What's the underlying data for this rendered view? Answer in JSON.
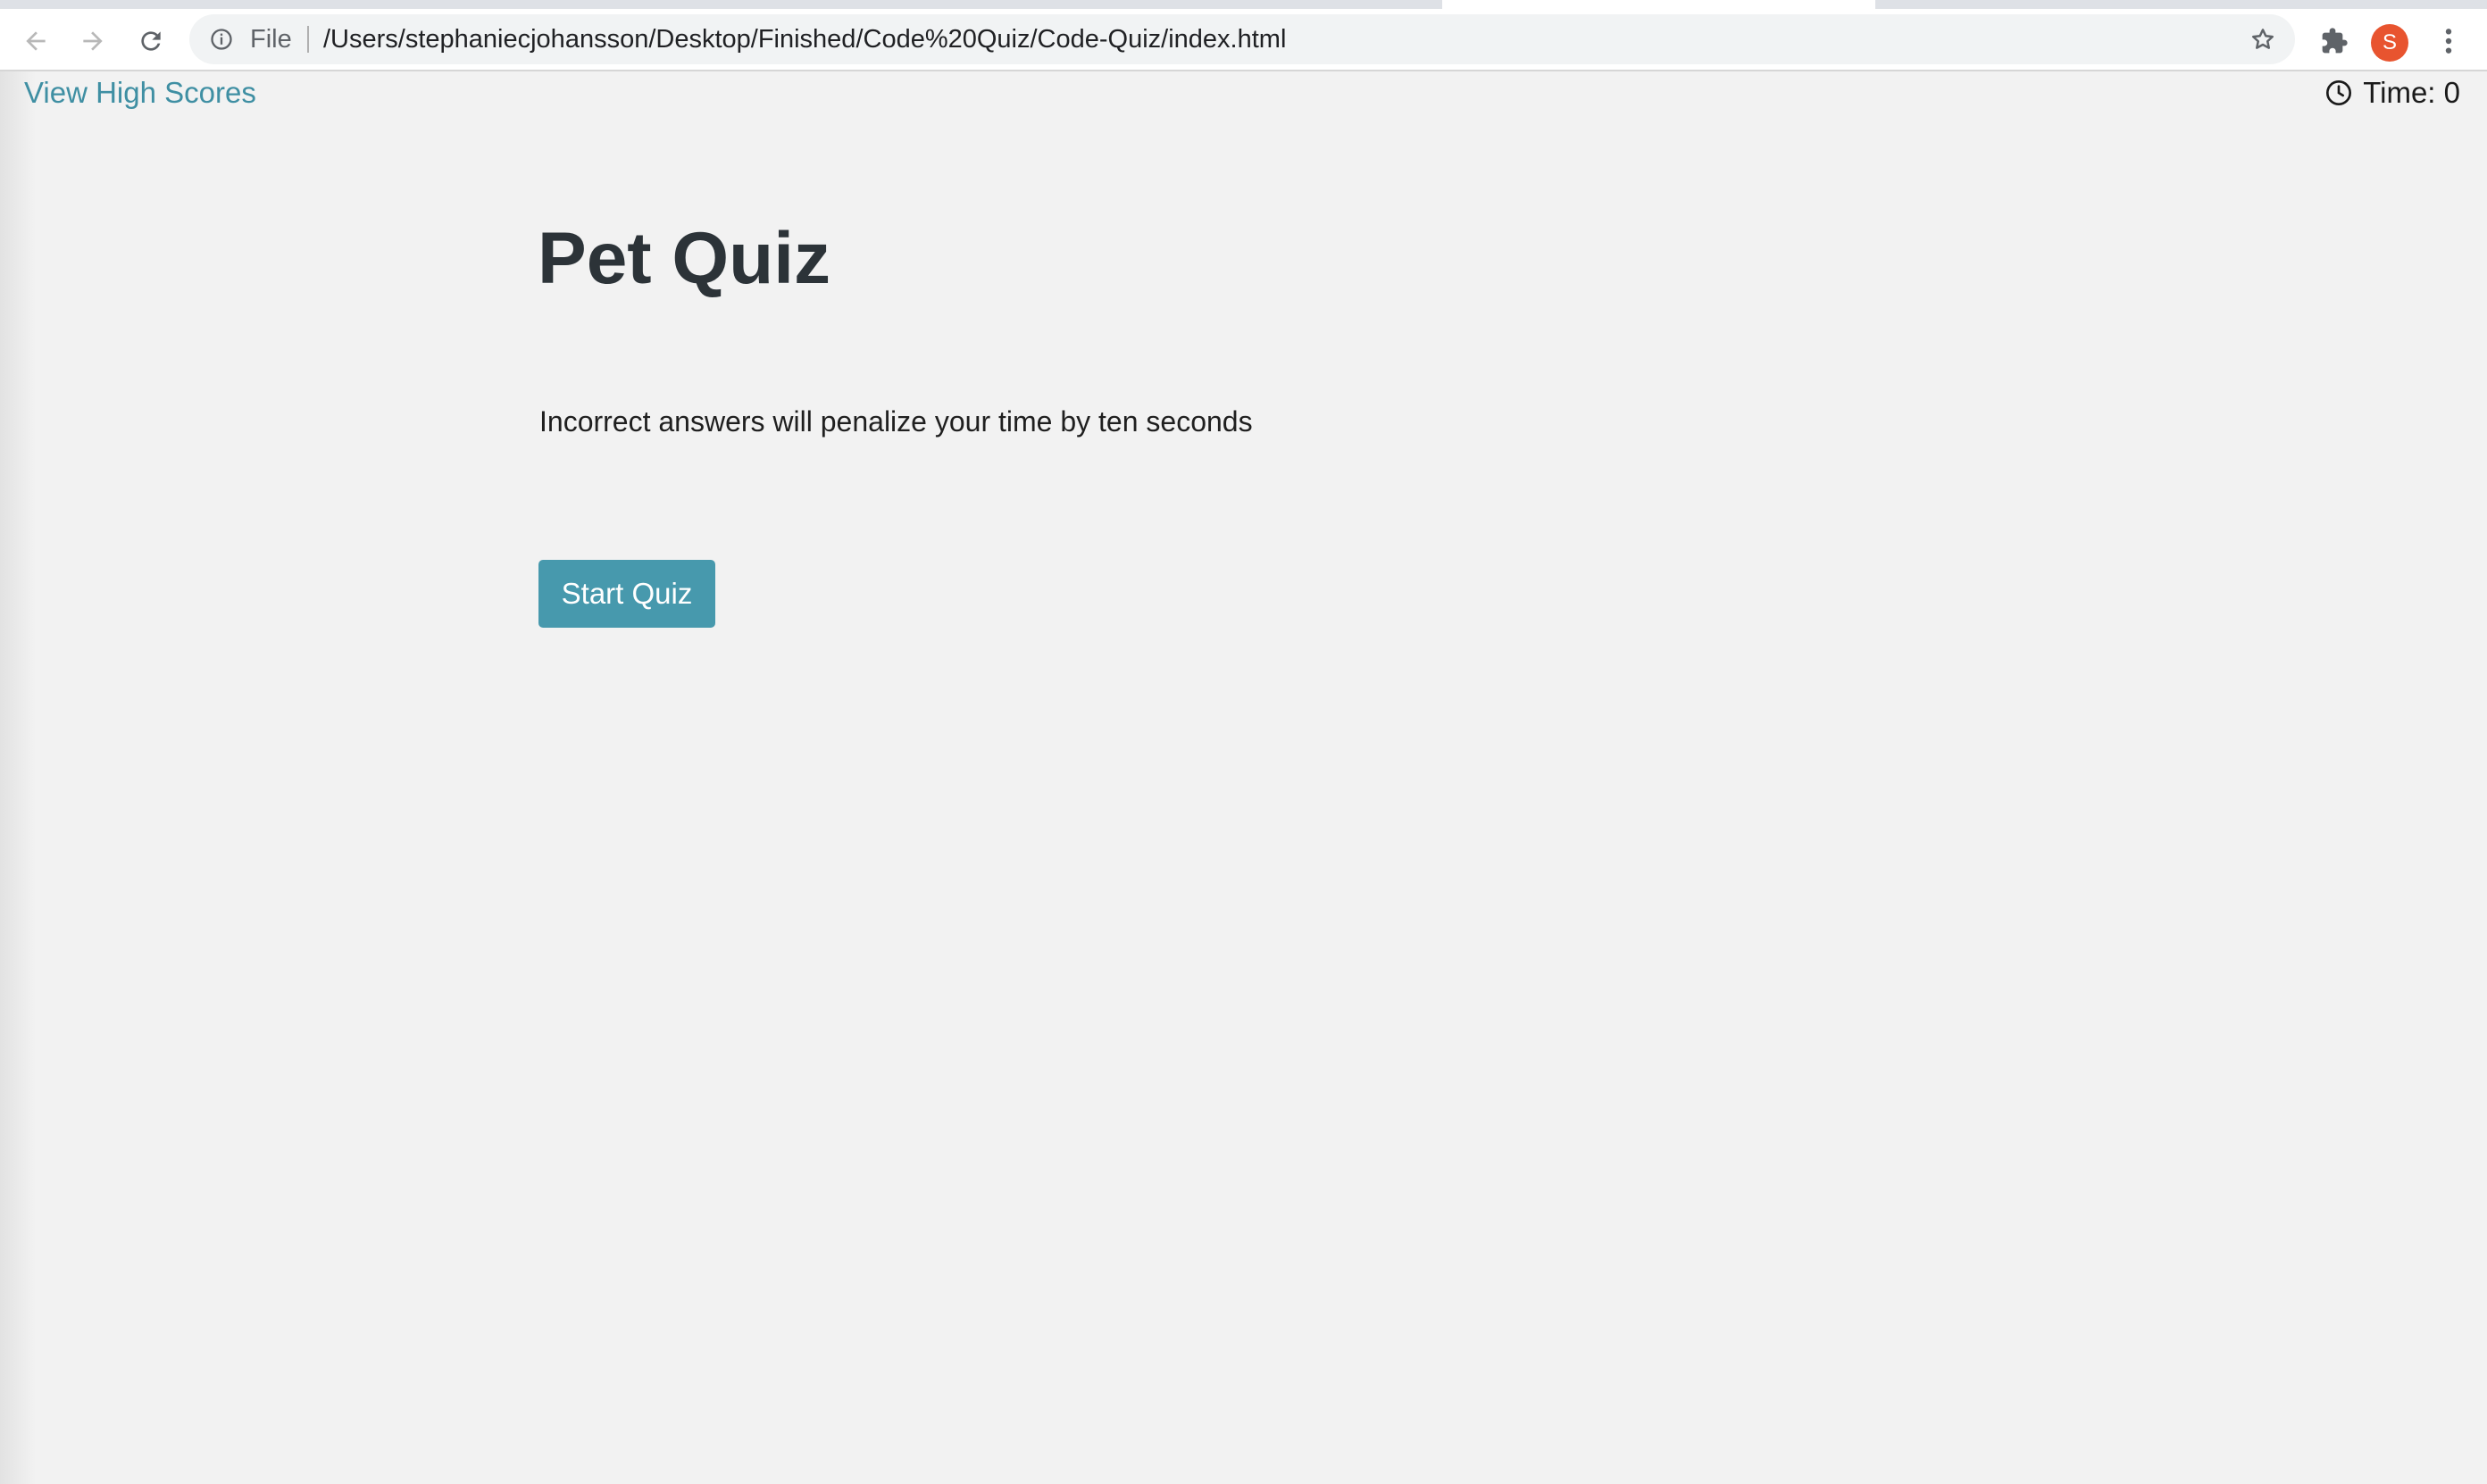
{
  "browser": {
    "url_scheme": "File",
    "url": "/Users/stephaniecjohansson/Desktop/Finished/Code%20Quiz/Code-Quiz/index.html",
    "avatar_initial": "S",
    "avatar_color": "#e8542f",
    "icons": [
      "back-arrow-icon",
      "forward-arrow-icon",
      "reload-icon",
      "info-icon",
      "star-icon",
      "extensions-puzzle-icon",
      "kebab-menu-icon"
    ]
  },
  "page": {
    "high_scores_label": "View High Scores",
    "timer_label": "Time: 0",
    "title": "Pet Quiz",
    "description": "Incorrect answers will penalize your time by ten seconds",
    "start_button_label": "Start Quiz",
    "colors": {
      "link": "#3f8fa3",
      "button": "#4799ad",
      "title": "#2c3338",
      "background": "#f2f2f2"
    }
  }
}
